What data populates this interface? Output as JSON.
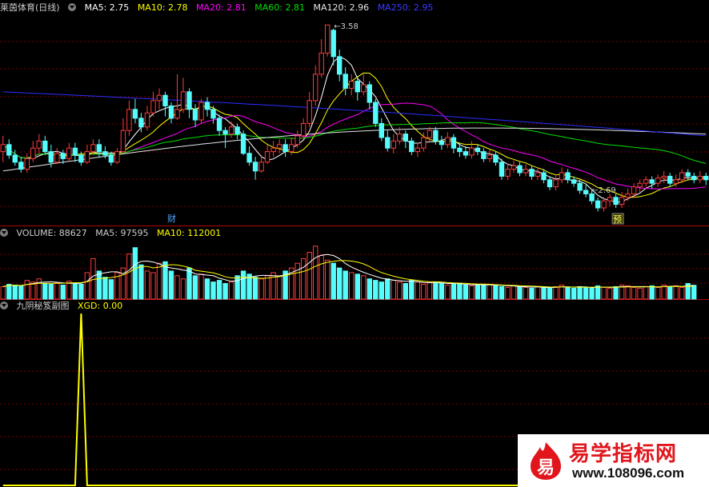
{
  "colors": {
    "up": "#ff3b3b",
    "down": "#54fcfc",
    "ma5": "#ffffff",
    "ma10": "#ffff00",
    "ma20": "#ff00ff",
    "ma60": "#00e000",
    "ma120": "#e6e6e6",
    "ma250": "#2d2dff",
    "divider": "#b40000",
    "grid": "#7a0000",
    "label": "#cccccc",
    "xgd": "#ffff00"
  },
  "price_header": {
    "name": "莱茵体育(日线)",
    "items": [
      {
        "label": "MA5: 2.75",
        "color": "#ffffff"
      },
      {
        "label": "MA10: 2.78",
        "color": "#ffff00"
      },
      {
        "label": "MA20: 2.81",
        "color": "#ff00ff"
      },
      {
        "label": "MA60: 2.81",
        "color": "#00e000"
      },
      {
        "label": "MA120: 2.96",
        "color": "#e6e6e6"
      },
      {
        "label": "MA250: 2.95",
        "color": "#3a3aff"
      }
    ]
  },
  "volume_header": {
    "items": [
      {
        "label": "VOLUME: 88627",
        "color": "#cccccc"
      },
      {
        "label": "MA5: 97595",
        "color": "#cccccc"
      },
      {
        "label": "MA10: 112001",
        "color": "#ffff00"
      }
    ]
  },
  "indicator_header": {
    "items": [
      {
        "label": "九阴秘笈副图",
        "color": "#cccccc"
      },
      {
        "label": "XGD: 0.00",
        "color": "#ffff00"
      }
    ]
  },
  "annotations": {
    "high": "3.58",
    "low": "2.69",
    "cai_marker": "财",
    "yu_marker": "预"
  },
  "watermark": {
    "logo_char": "易",
    "title": "易学指标网",
    "url": "www.108096.com"
  },
  "chart_data": [
    {
      "type": "candlestick",
      "title": "莱茵体育(日线)",
      "candles": [
        [
          2.86,
          2.9,
          2.95,
          2.8
        ],
        [
          2.9,
          2.84,
          2.93,
          2.82
        ],
        [
          2.84,
          2.8,
          2.87,
          2.78
        ],
        [
          2.8,
          2.76,
          2.83,
          2.74
        ],
        [
          2.76,
          2.82,
          2.85,
          2.74
        ],
        [
          2.82,
          2.88,
          2.92,
          2.8
        ],
        [
          2.88,
          2.92,
          2.96,
          2.85
        ],
        [
          2.92,
          2.86,
          2.95,
          2.84
        ],
        [
          2.86,
          2.8,
          2.9,
          2.77
        ],
        [
          2.8,
          2.85,
          2.88,
          2.79
        ],
        [
          2.85,
          2.82,
          2.87,
          2.79
        ],
        [
          2.82,
          2.88,
          2.91,
          2.8
        ],
        [
          2.88,
          2.84,
          2.91,
          2.8
        ],
        [
          2.84,
          2.8,
          2.86,
          2.78
        ],
        [
          2.8,
          2.86,
          2.9,
          2.79
        ],
        [
          2.86,
          2.9,
          2.93,
          2.84
        ],
        [
          2.9,
          2.86,
          2.93,
          2.83
        ],
        [
          2.86,
          2.84,
          2.89,
          2.82
        ],
        [
          2.84,
          2.8,
          2.86,
          2.78
        ],
        [
          2.8,
          2.86,
          2.88,
          2.79
        ],
        [
          2.86,
          2.98,
          3.05,
          2.85
        ],
        [
          2.98,
          3.1,
          3.15,
          2.95
        ],
        [
          3.1,
          3.05,
          3.16,
          3.02
        ],
        [
          3.05,
          3.0,
          3.08,
          2.97
        ],
        [
          3.0,
          3.08,
          3.12,
          2.98
        ],
        [
          3.08,
          3.15,
          3.2,
          3.06
        ],
        [
          3.15,
          3.18,
          3.22,
          3.1
        ],
        [
          3.18,
          3.12,
          3.2,
          3.06
        ],
        [
          3.12,
          3.05,
          3.14,
          3.02
        ],
        [
          3.05,
          3.1,
          3.3,
          3.04
        ],
        [
          3.1,
          3.2,
          3.28,
          3.08
        ],
        [
          3.2,
          3.1,
          3.22,
          3.05
        ],
        [
          3.1,
          3.04,
          3.13,
          3.0
        ],
        [
          3.04,
          3.14,
          3.16,
          3.02
        ],
        [
          3.14,
          3.1,
          3.17,
          3.06
        ],
        [
          3.1,
          3.05,
          3.12,
          3.02
        ],
        [
          3.05,
          2.98,
          3.07,
          2.95
        ],
        [
          2.98,
          2.96,
          3.0,
          2.88
        ],
        [
          2.96,
          3.0,
          3.03,
          2.94
        ],
        [
          3.0,
          2.96,
          3.02,
          2.93
        ],
        [
          2.96,
          2.85,
          2.98,
          2.84
        ],
        [
          2.85,
          2.8,
          2.89,
          2.78
        ],
        [
          2.8,
          2.75,
          2.83,
          2.7
        ],
        [
          2.75,
          2.8,
          2.84,
          2.74
        ],
        [
          2.8,
          2.86,
          2.9,
          2.79
        ],
        [
          2.86,
          2.88,
          2.92,
          2.83
        ],
        [
          2.88,
          2.9,
          2.93,
          2.85
        ],
        [
          2.9,
          2.86,
          2.93,
          2.83
        ],
        [
          2.86,
          2.9,
          2.94,
          2.84
        ],
        [
          2.9,
          2.95,
          2.98,
          2.88
        ],
        [
          2.95,
          3.02,
          3.05,
          2.93
        ],
        [
          3.02,
          3.15,
          3.2,
          3.0
        ],
        [
          3.15,
          3.3,
          3.35,
          3.12
        ],
        [
          3.3,
          3.42,
          3.5,
          3.28
        ],
        [
          3.42,
          3.58,
          3.58,
          3.4
        ],
        [
          3.55,
          3.4,
          3.56,
          3.35
        ],
        [
          3.4,
          3.3,
          3.44,
          3.26
        ],
        [
          3.3,
          3.22,
          3.34,
          3.18
        ],
        [
          3.22,
          3.26,
          3.3,
          3.18
        ],
        [
          3.26,
          3.2,
          3.29,
          3.15
        ],
        [
          3.2,
          3.24,
          3.3,
          3.18
        ],
        [
          3.24,
          3.14,
          3.26,
          3.1
        ],
        [
          3.14,
          3.02,
          3.16,
          3.0
        ],
        [
          3.02,
          2.94,
          3.05,
          2.92
        ],
        [
          2.94,
          2.88,
          2.98,
          2.86
        ],
        [
          2.88,
          2.92,
          2.96,
          2.85
        ],
        [
          2.92,
          2.96,
          3.0,
          2.9
        ],
        [
          2.96,
          2.92,
          2.98,
          2.88
        ],
        [
          2.92,
          2.86,
          2.94,
          2.84
        ],
        [
          2.86,
          2.88,
          2.91,
          2.83
        ],
        [
          2.88,
          2.94,
          2.97,
          2.86
        ],
        [
          2.94,
          2.98,
          3.0,
          2.92
        ],
        [
          2.98,
          2.92,
          3.0,
          2.9
        ],
        [
          2.92,
          2.9,
          2.95,
          2.87
        ],
        [
          2.9,
          2.94,
          2.97,
          2.88
        ],
        [
          2.94,
          2.88,
          2.96,
          2.85
        ],
        [
          2.88,
          2.86,
          2.91,
          2.83
        ],
        [
          2.86,
          2.84,
          2.89,
          2.82
        ],
        [
          2.84,
          2.88,
          2.92,
          2.82
        ],
        [
          2.88,
          2.86,
          2.9,
          2.84
        ],
        [
          2.86,
          2.82,
          2.88,
          2.8
        ],
        [
          2.82,
          2.84,
          2.87,
          2.8
        ],
        [
          2.84,
          2.8,
          2.86,
          2.78
        ],
        [
          2.8,
          2.72,
          2.82,
          2.7
        ],
        [
          2.72,
          2.76,
          2.79,
          2.7
        ],
        [
          2.76,
          2.78,
          2.81,
          2.74
        ],
        [
          2.78,
          2.74,
          2.8,
          2.72
        ],
        [
          2.74,
          2.76,
          2.79,
          2.72
        ],
        [
          2.76,
          2.72,
          2.78,
          2.7
        ],
        [
          2.72,
          2.74,
          2.77,
          2.7
        ],
        [
          2.74,
          2.7,
          2.76,
          2.68
        ],
        [
          2.7,
          2.66,
          2.72,
          2.64
        ],
        [
          2.66,
          2.7,
          2.73,
          2.64
        ],
        [
          2.7,
          2.74,
          2.77,
          2.68
        ],
        [
          2.74,
          2.7,
          2.76,
          2.68
        ],
        [
          2.7,
          2.68,
          2.72,
          2.66
        ],
        [
          2.68,
          2.64,
          2.7,
          2.62
        ],
        [
          2.64,
          2.62,
          2.67,
          2.6
        ],
        [
          2.62,
          2.58,
          2.64,
          2.56
        ],
        [
          2.58,
          2.54,
          2.6,
          2.52
        ],
        [
          2.54,
          2.58,
          2.6,
          2.52
        ],
        [
          2.58,
          2.6,
          2.62,
          2.55
        ],
        [
          2.6,
          2.56,
          2.62,
          2.54
        ],
        [
          2.56,
          2.6,
          2.63,
          2.54
        ],
        [
          2.6,
          2.62,
          2.65,
          2.58
        ],
        [
          2.62,
          2.66,
          2.68,
          2.6
        ],
        [
          2.66,
          2.68,
          2.7,
          2.63
        ],
        [
          2.68,
          2.7,
          2.72,
          2.66
        ],
        [
          2.7,
          2.68,
          2.72,
          2.65
        ],
        [
          2.68,
          2.71,
          2.73,
          2.66
        ],
        [
          2.71,
          2.72,
          2.75,
          2.68
        ],
        [
          2.72,
          2.68,
          2.74,
          2.66
        ],
        [
          2.68,
          2.7,
          2.73,
          2.66
        ],
        [
          2.7,
          2.74,
          2.76,
          2.68
        ],
        [
          2.74,
          2.72,
          2.76,
          2.7
        ],
        [
          2.72,
          2.7,
          2.74,
          2.68
        ],
        [
          2.7,
          2.72,
          2.75,
          2.68
        ],
        [
          2.72,
          2.7,
          2.74,
          2.67
        ]
      ],
      "ma": {
        "MA5": 2.75,
        "MA10": 2.78,
        "MA20": 2.81,
        "MA60": 2.81,
        "MA120": 2.96,
        "MA250": 2.95
      },
      "ylim": [
        2.44,
        3.64
      ],
      "high_label": 3.58,
      "low_label": 2.69
    },
    {
      "type": "bar",
      "title": "VOLUME",
      "values": [
        80000,
        95000,
        90000,
        85000,
        120000,
        110000,
        130000,
        100000,
        95000,
        105000,
        90000,
        115000,
        100000,
        95000,
        170000,
        260000,
        180000,
        140000,
        125000,
        170000,
        200000,
        290000,
        330000,
        220000,
        180000,
        170000,
        230000,
        240000,
        180000,
        150000,
        130000,
        200000,
        150000,
        160000,
        130000,
        110000,
        120000,
        100000,
        110000,
        150000,
        180000,
        160000,
        140000,
        130000,
        150000,
        170000,
        150000,
        180000,
        200000,
        230000,
        260000,
        300000,
        340000,
        280000,
        250000,
        230000,
        200000,
        180000,
        170000,
        160000,
        150000,
        130000,
        120000,
        110000,
        130000,
        120000,
        110000,
        100000,
        120000,
        110000,
        95000,
        105000,
        110000,
        100000,
        90000,
        95000,
        100000,
        90000,
        85000,
        95000,
        90000,
        95000,
        85000,
        80000,
        75000,
        85000,
        80000,
        75000,
        70000,
        80000,
        75000,
        70000,
        80000,
        90000,
        75000,
        70000,
        80000,
        75000,
        70000,
        85000,
        75000,
        70000,
        80000,
        90000,
        85000,
        75000,
        70000,
        80000,
        85000,
        75000,
        90000,
        80000,
        85000,
        75000,
        100000,
        88627
      ],
      "ylim": [
        0,
        380000
      ],
      "series_labels": [
        "VOLUME: 88627",
        "MA5: 97595",
        "MA10: 112001"
      ]
    },
    {
      "type": "line",
      "title": "九阴秘笈副图",
      "series": [
        {
          "name": "XGD",
          "values": "spike at bar 13 (value 1), 0 elsewhere"
        }
      ],
      "spike_index": 13,
      "ylim": [
        0,
        1
      ]
    }
  ]
}
